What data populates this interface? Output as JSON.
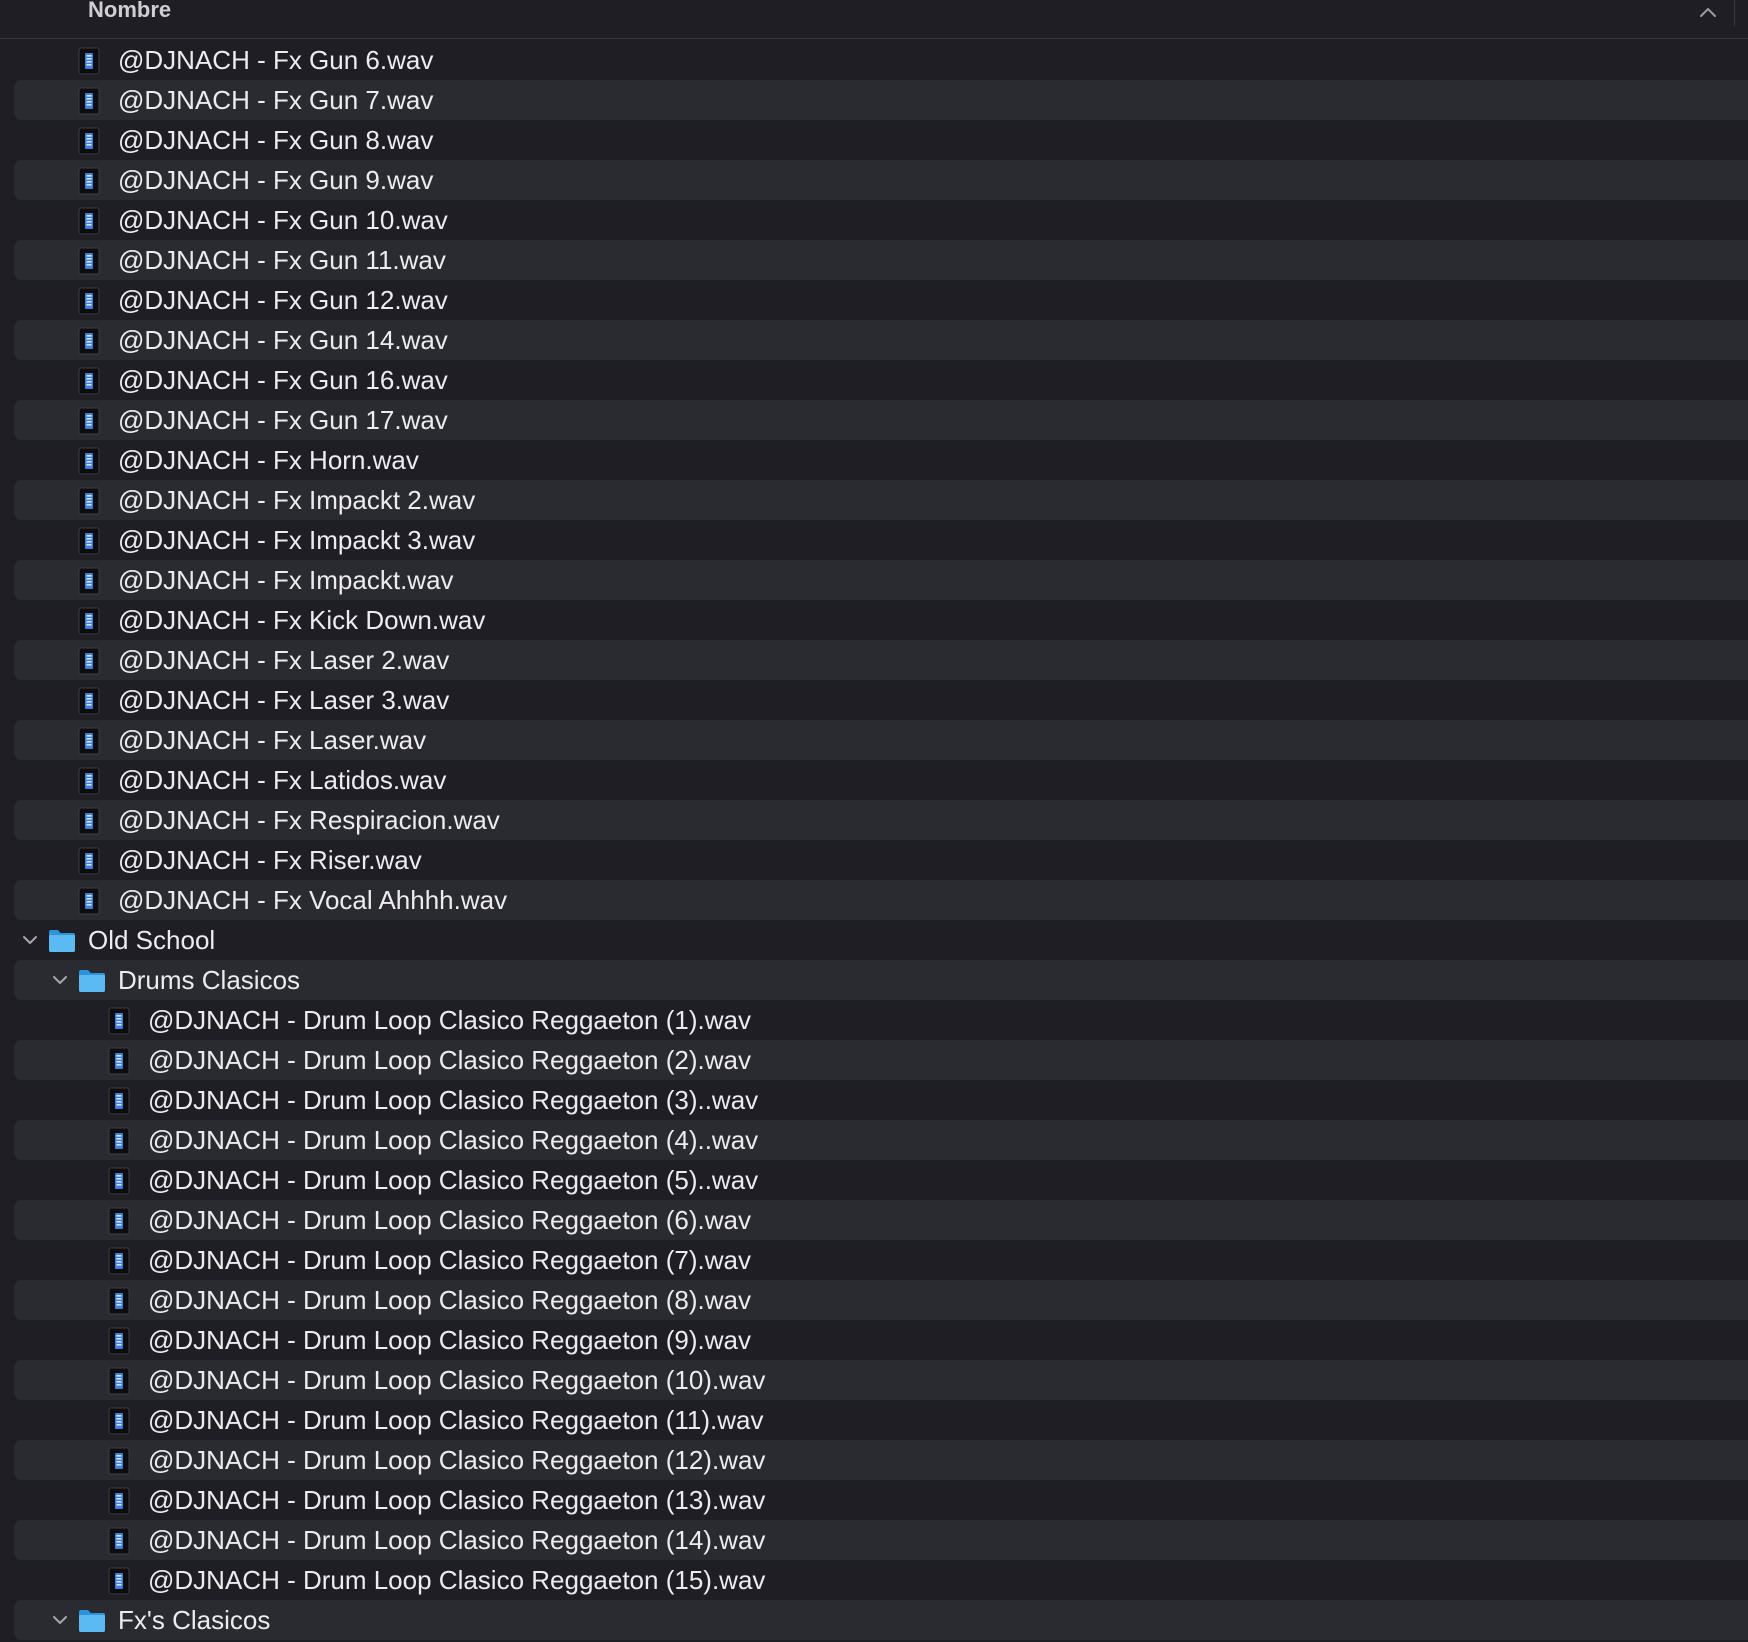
{
  "header": {
    "column_label": "Nombre",
    "sort_icon": "chevron-up-icon"
  },
  "rows": [
    {
      "kind": "file",
      "depth": 1,
      "label": "@DJNACH - Fx Gun 6.wav"
    },
    {
      "kind": "file",
      "depth": 1,
      "label": "@DJNACH - Fx Gun 7.wav"
    },
    {
      "kind": "file",
      "depth": 1,
      "label": "@DJNACH - Fx Gun 8.wav"
    },
    {
      "kind": "file",
      "depth": 1,
      "label": "@DJNACH - Fx Gun 9.wav"
    },
    {
      "kind": "file",
      "depth": 1,
      "label": "@DJNACH - Fx Gun 10.wav"
    },
    {
      "kind": "file",
      "depth": 1,
      "label": "@DJNACH - Fx Gun 11.wav"
    },
    {
      "kind": "file",
      "depth": 1,
      "label": "@DJNACH - Fx Gun 12.wav"
    },
    {
      "kind": "file",
      "depth": 1,
      "label": "@DJNACH - Fx Gun 14.wav"
    },
    {
      "kind": "file",
      "depth": 1,
      "label": "@DJNACH - Fx Gun 16.wav"
    },
    {
      "kind": "file",
      "depth": 1,
      "label": "@DJNACH - Fx Gun 17.wav"
    },
    {
      "kind": "file",
      "depth": 1,
      "label": "@DJNACH - Fx Horn.wav"
    },
    {
      "kind": "file",
      "depth": 1,
      "label": "@DJNACH - Fx Impackt 2.wav"
    },
    {
      "kind": "file",
      "depth": 1,
      "label": "@DJNACH - Fx Impackt 3.wav"
    },
    {
      "kind": "file",
      "depth": 1,
      "label": "@DJNACH - Fx Impackt.wav"
    },
    {
      "kind": "file",
      "depth": 1,
      "label": "@DJNACH - Fx Kick Down.wav"
    },
    {
      "kind": "file",
      "depth": 1,
      "label": "@DJNACH - Fx Laser 2.wav"
    },
    {
      "kind": "file",
      "depth": 1,
      "label": "@DJNACH - Fx Laser 3.wav"
    },
    {
      "kind": "file",
      "depth": 1,
      "label": "@DJNACH - Fx Laser.wav"
    },
    {
      "kind": "file",
      "depth": 1,
      "label": "@DJNACH - Fx Latidos.wav"
    },
    {
      "kind": "file",
      "depth": 1,
      "label": "@DJNACH - Fx Respiracion.wav"
    },
    {
      "kind": "file",
      "depth": 1,
      "label": "@DJNACH - Fx Riser.wav"
    },
    {
      "kind": "file",
      "depth": 1,
      "label": "@DJNACH - Fx Vocal Ahhhh.wav"
    },
    {
      "kind": "folder",
      "depth": 0,
      "expanded": true,
      "label": "Old School"
    },
    {
      "kind": "folder",
      "depth": 1,
      "expanded": true,
      "label": "Drums Clasicos"
    },
    {
      "kind": "file",
      "depth": 2,
      "label": "@DJNACH - Drum Loop Clasico Reggaeton (1).wav"
    },
    {
      "kind": "file",
      "depth": 2,
      "label": "@DJNACH - Drum Loop Clasico Reggaeton (2).wav"
    },
    {
      "kind": "file",
      "depth": 2,
      "label": "@DJNACH - Drum Loop Clasico Reggaeton (3)..wav"
    },
    {
      "kind": "file",
      "depth": 2,
      "label": "@DJNACH - Drum Loop Clasico Reggaeton (4)..wav"
    },
    {
      "kind": "file",
      "depth": 2,
      "label": "@DJNACH - Drum Loop Clasico Reggaeton (5)..wav"
    },
    {
      "kind": "file",
      "depth": 2,
      "label": "@DJNACH - Drum Loop Clasico Reggaeton (6).wav"
    },
    {
      "kind": "file",
      "depth": 2,
      "label": "@DJNACH - Drum Loop Clasico Reggaeton (7).wav"
    },
    {
      "kind": "file",
      "depth": 2,
      "label": "@DJNACH - Drum Loop Clasico Reggaeton (8).wav"
    },
    {
      "kind": "file",
      "depth": 2,
      "label": "@DJNACH - Drum Loop Clasico Reggaeton (9).wav"
    },
    {
      "kind": "file",
      "depth": 2,
      "label": "@DJNACH - Drum Loop Clasico Reggaeton (10).wav"
    },
    {
      "kind": "file",
      "depth": 2,
      "label": "@DJNACH - Drum Loop Clasico Reggaeton (11).wav"
    },
    {
      "kind": "file",
      "depth": 2,
      "label": "@DJNACH - Drum Loop Clasico Reggaeton (12).wav"
    },
    {
      "kind": "file",
      "depth": 2,
      "label": "@DJNACH - Drum Loop Clasico Reggaeton (13).wav"
    },
    {
      "kind": "file",
      "depth": 2,
      "label": "@DJNACH - Drum Loop Clasico Reggaeton (14).wav"
    },
    {
      "kind": "file",
      "depth": 2,
      "label": "@DJNACH - Drum Loop Clasico Reggaeton (15).wav"
    },
    {
      "kind": "folder",
      "depth": 1,
      "expanded": true,
      "label": "Fx's Clasicos"
    }
  ],
  "icons": {
    "file": "audio-file-icon",
    "folder": "folder-icon",
    "disclosure": "chevron-down-icon"
  },
  "colors": {
    "background": "#1e1e24",
    "row_alt": "#2a2a31",
    "folder_blue": "#4fb3f0",
    "text": "#ececee"
  }
}
